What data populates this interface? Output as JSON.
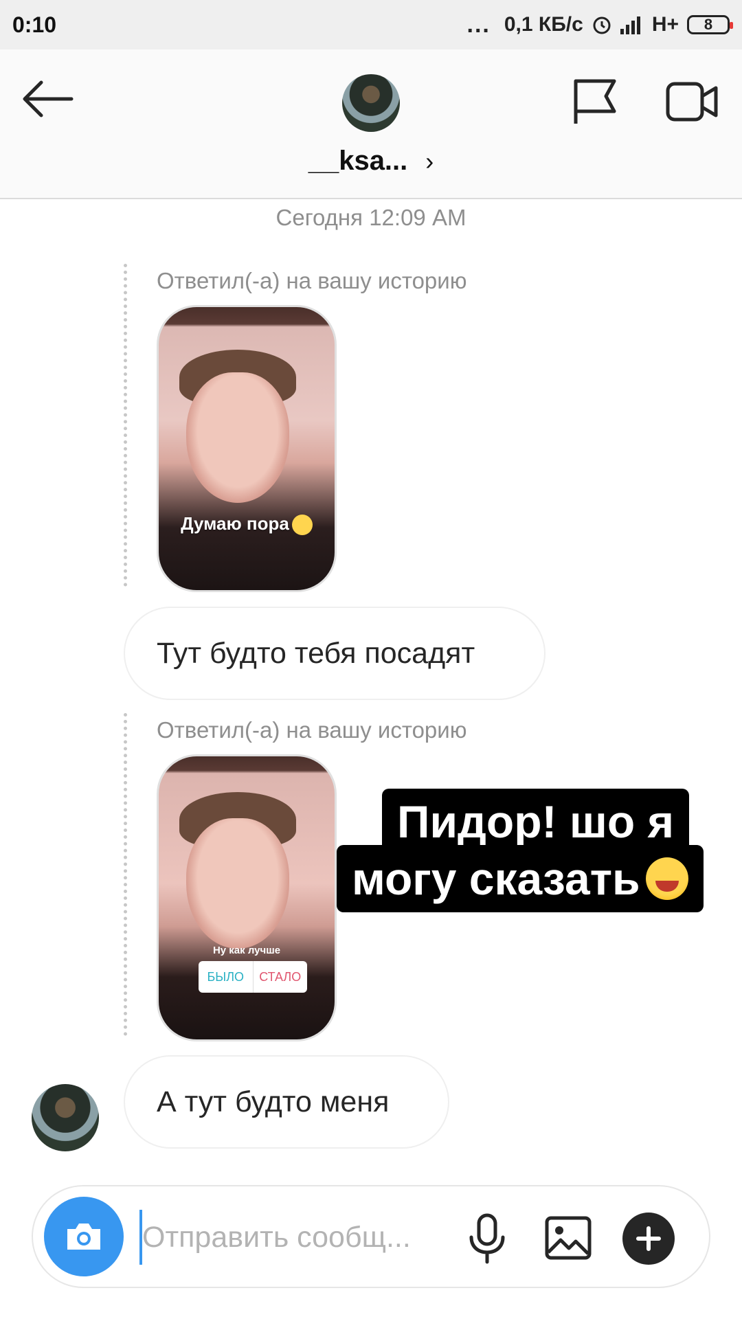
{
  "status_bar": {
    "time": "0:10",
    "dots": "...",
    "speed": "0,1 КБ/с",
    "network": "H+",
    "battery": "8"
  },
  "header": {
    "username": "__ksa...",
    "chevron": "›"
  },
  "chat": {
    "timestamp": "Сегодня 12:09 AM",
    "story_reply_1": {
      "label": "Ответил(-а) на вашу историю",
      "caption": "Думаю пора"
    },
    "message_1": "Тут будто тебя посадят",
    "story_reply_2": {
      "label": "Ответил(-а) на вашу историю",
      "poll_question": "Ну как лучше",
      "poll_option_a": "БЫЛО",
      "poll_option_b": "СТАЛО"
    },
    "message_2": "А тут будто меня"
  },
  "overlay_text": {
    "line1": "Пидор! шо я",
    "line2": "могу сказать"
  },
  "composer": {
    "placeholder": "Отправить сообщ..."
  },
  "icons": {
    "back": "arrow-left-icon",
    "flag": "flag-icon",
    "video": "video-call-icon",
    "camera": "camera-icon",
    "mic": "microphone-icon",
    "gallery": "image-icon",
    "plus": "plus-icon"
  },
  "colors": {
    "accent": "#3897f0",
    "bubble_border": "#efefef",
    "muted_text": "#8e8e8e",
    "sticker_bg": "#000000"
  }
}
